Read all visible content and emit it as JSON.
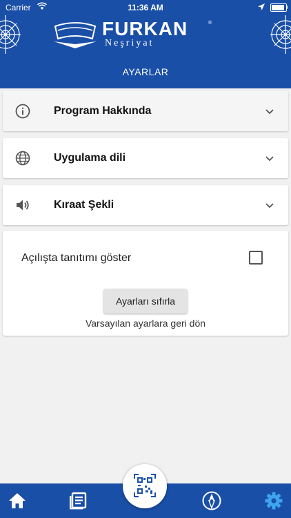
{
  "status_bar": {
    "carrier": "Carrier",
    "time": "11:36 AM"
  },
  "header": {
    "brand": "FURKAN",
    "brand_registered": "®",
    "subtitle": "Neşriyat",
    "page_title": "AYARLAR"
  },
  "sections": [
    {
      "label": "Program Hakkında",
      "icon": "info-icon"
    },
    {
      "label": "Uygulama dili",
      "icon": "globe-icon"
    },
    {
      "label": "Kıraat Şekli",
      "icon": "volume-icon"
    }
  ],
  "settings": {
    "show_intro_label": "Açılışta tanıtımı göster",
    "show_intro_checked": false,
    "reset_button": "Ayarları sıfırla",
    "reset_description": "Varsayılan ayarlara geri dön"
  },
  "tabbar": {
    "tabs": [
      {
        "icon": "home-icon",
        "active": false
      },
      {
        "icon": "news-icon",
        "active": false
      },
      {
        "icon": "qr-code-icon",
        "active": false
      },
      {
        "icon": "compass-icon",
        "active": false
      },
      {
        "icon": "settings-gear-icon",
        "active": true
      }
    ]
  },
  "colors": {
    "primary": "#1a4fa8",
    "active_tab": "#3ea4f0",
    "background": "#f1f1f1"
  }
}
